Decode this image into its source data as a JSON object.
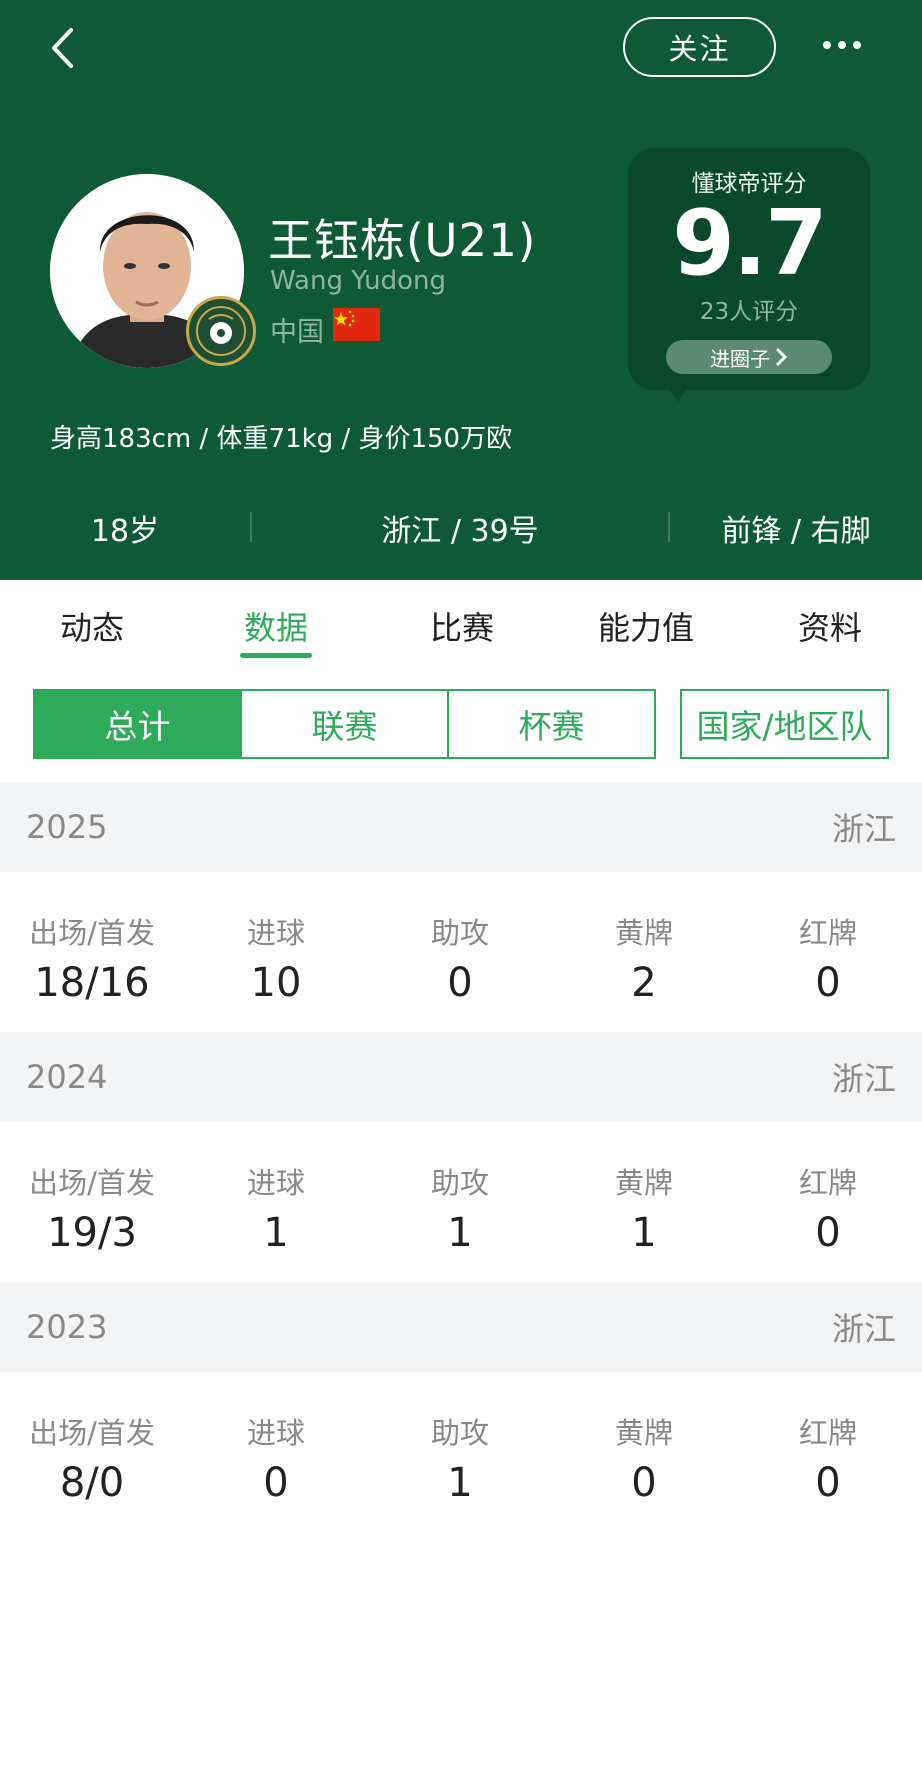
{
  "header": {
    "follow_label": "关注",
    "player_name": "王钰栋(U21)",
    "player_name_en": "Wang Yudong",
    "nationality": "中国",
    "flag_icon": "china-flag-icon",
    "rating": {
      "title": "懂球帝评分",
      "score": "9.7",
      "count": "23人评分",
      "circle_label": "进圈子"
    },
    "body_stats": "身高183cm / 体重71kg / 身价150万欧",
    "age": "18岁",
    "team_number": "浙江 / 39号",
    "position_foot": "前锋 / 右脚"
  },
  "tabs": [
    "动态",
    "数据",
    "比赛",
    "能力值",
    "资料"
  ],
  "active_tab": "数据",
  "segments": [
    "总计",
    "联赛",
    "杯赛"
  ],
  "active_segment": "总计",
  "national_team_label": "国家/地区队",
  "stat_labels": [
    "出场/首发",
    "进球",
    "助攻",
    "黄牌",
    "红牌"
  ],
  "seasons": [
    {
      "year": "2025",
      "team": "浙江",
      "values": [
        "18/16",
        "10",
        "0",
        "2",
        "0"
      ]
    },
    {
      "year": "2024",
      "team": "浙江",
      "values": [
        "19/3",
        "1",
        "1",
        "1",
        "0"
      ]
    },
    {
      "year": "2023",
      "team": "浙江",
      "values": [
        "8/0",
        "0",
        "1",
        "0",
        "0"
      ]
    }
  ],
  "colors": {
    "header_bg": "#0d5a35",
    "accent_green": "#2eab58",
    "flag_red": "#de2910"
  }
}
